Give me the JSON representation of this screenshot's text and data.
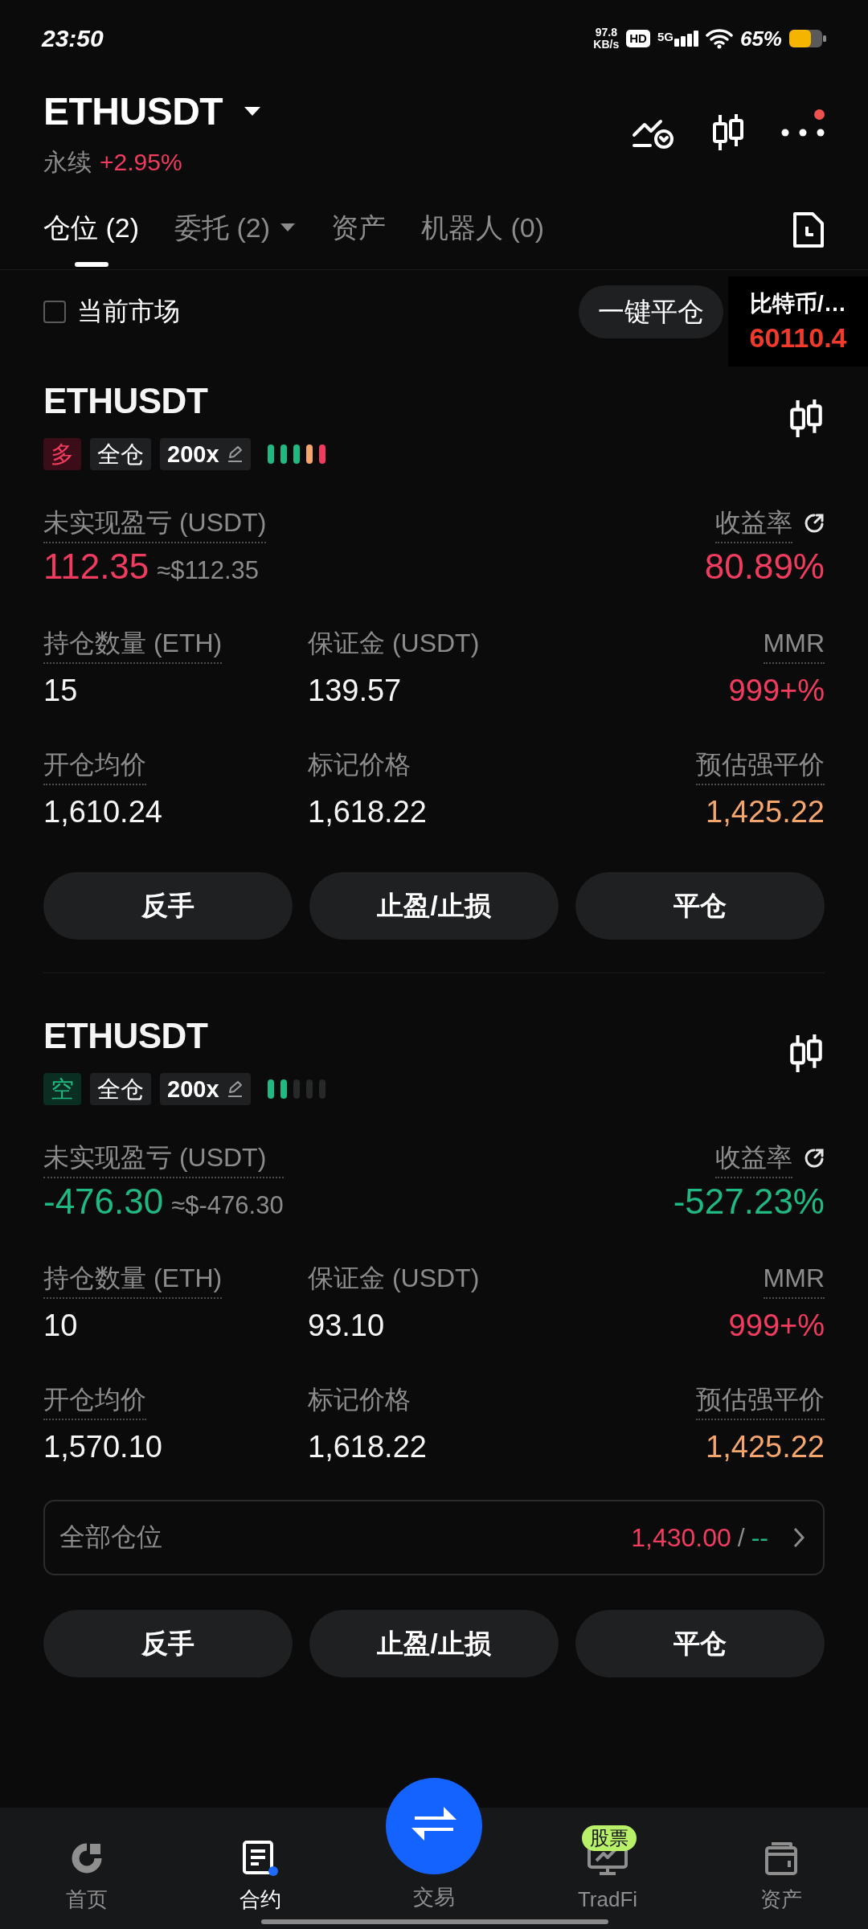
{
  "status_bar": {
    "time": "23:50",
    "net_speed": "97.8",
    "net_speed_unit": "KB/s",
    "hd_label": "HD",
    "network": "5G",
    "battery": "65%"
  },
  "header": {
    "symbol": "ETHUSDT",
    "contract_type": "永续",
    "change": "+2.95%",
    "rising": true,
    "notification": true
  },
  "tabs": [
    {
      "label": "仓位 (2)",
      "selected": true,
      "dropdown": false
    },
    {
      "label": "委托 (2)",
      "selected": false,
      "dropdown": true
    },
    {
      "label": "资产",
      "selected": false,
      "dropdown": false
    },
    {
      "label": "机器人 (0)",
      "selected": false,
      "dropdown": false
    }
  ],
  "filter": {
    "label": "当前市场",
    "checked": false
  },
  "close_all_button": "一键平仓",
  "floating_ticker": {
    "name": "比特币/…",
    "price": "60110.4"
  },
  "positions": [
    {
      "kind": "long",
      "symbol": "ETHUSDT",
      "side_label": "多",
      "margin_mode": "全仓",
      "leverage": "200x",
      "risk_segments": [
        {
          "lit": true
        },
        {
          "lit": true
        },
        {
          "lit": true
        },
        {
          "lit": true
        },
        {
          "lit": true
        }
      ],
      "pnl": {
        "label": "未实现盈亏 (USDT)",
        "value": "112.35",
        "approx": "≈$112.35",
        "rising": true,
        "dotted": true
      },
      "roe": {
        "label": "收益率",
        "value": "80.89%",
        "rising": true,
        "dotted": true
      },
      "fields": [
        {
          "kind": "plain",
          "label": "持仓数量 (ETH)",
          "value": "15",
          "dotted": true
        },
        {
          "kind": "plain",
          "label": "保证金 (USDT)",
          "value": "139.57",
          "dotted": false
        },
        {
          "kind": "alert",
          "label": "MMR",
          "value": "999+%",
          "dotted": true
        },
        {
          "kind": "plain",
          "label": "开仓均价",
          "value": "1,610.24",
          "dotted": true
        },
        {
          "kind": "plain",
          "label": "标记价格",
          "value": "1,618.22",
          "dotted": false
        },
        {
          "kind": "warning",
          "label": "预估强平价",
          "value": "1,425.22",
          "dotted": true
        }
      ],
      "buttons": [
        "反手",
        "止盈/止损",
        "平仓"
      ]
    },
    {
      "kind": "short",
      "symbol": "ETHUSDT",
      "side_label": "空",
      "margin_mode": "全仓",
      "leverage": "200x",
      "risk_segments": [
        {
          "lit": true
        },
        {
          "lit": true
        },
        {
          "lit": false
        },
        {
          "lit": false
        },
        {
          "lit": false
        }
      ],
      "pnl": {
        "label": "未实现盈亏 (USDT)",
        "value": "-476.30",
        "approx": "≈$-476.30",
        "rising": false,
        "dotted": true
      },
      "roe": {
        "label": "收益率",
        "value": "-527.23%",
        "rising": false,
        "dotted": true
      },
      "fields": [
        {
          "kind": "plain",
          "label": "持仓数量 (ETH)",
          "value": "10",
          "dotted": true
        },
        {
          "kind": "plain",
          "label": "保证金 (USDT)",
          "value": "93.10",
          "dotted": false
        },
        {
          "kind": "alert",
          "label": "MMR",
          "value": "999+%",
          "dotted": true
        },
        {
          "kind": "plain",
          "label": "开仓均价",
          "value": "1,570.10",
          "dotted": true
        },
        {
          "kind": "plain",
          "label": "标记价格",
          "value": "1,618.22",
          "dotted": false
        },
        {
          "kind": "warning",
          "label": "预估强平价",
          "value": "1,425.22",
          "dotted": true
        }
      ],
      "tpsl": {
        "label": "全部仓位",
        "take_profit": "1,430.00",
        "separator": "/",
        "stop_loss": "--"
      },
      "buttons": [
        "反手",
        "止盈/止损",
        "平仓"
      ]
    }
  ],
  "bottom_nav": [
    {
      "label": "首页",
      "kind": "tab",
      "selected": false
    },
    {
      "label": "合约",
      "kind": "tab",
      "selected": true
    },
    {
      "label": "交易",
      "kind": "fab",
      "selected": false
    },
    {
      "label": "TradFi",
      "kind": "tab",
      "selected": false,
      "badge": "股票"
    },
    {
      "label": "资产",
      "kind": "tab",
      "selected": false
    }
  ]
}
